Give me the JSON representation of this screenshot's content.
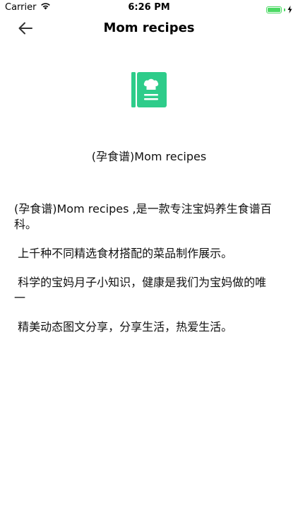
{
  "status_bar": {
    "carrier": "Carrier",
    "time": "6:26 PM",
    "battery_level": 1.0,
    "icons": [
      "wifi-icon",
      "battery-icon",
      "charging-icon"
    ]
  },
  "nav": {
    "title": "Mom recipes",
    "back_icon": "arrow-left-icon"
  },
  "app": {
    "icon": "recipe-book-icon",
    "icon_color": "#2ecc8a",
    "name": "(孕食谱)Mom recipes"
  },
  "description": {
    "paragraphs": [
      "(孕食谱)Mom recipes ,是一款专注宝妈养生食谱百科。",
      " 上千种不同精选食材搭配的菜品制作展示。",
      " 科学的宝妈月子小知识，健康是我们为宝妈做的唯一",
      " 精美动态图文分享，分享生活，热爱生活。"
    ]
  }
}
